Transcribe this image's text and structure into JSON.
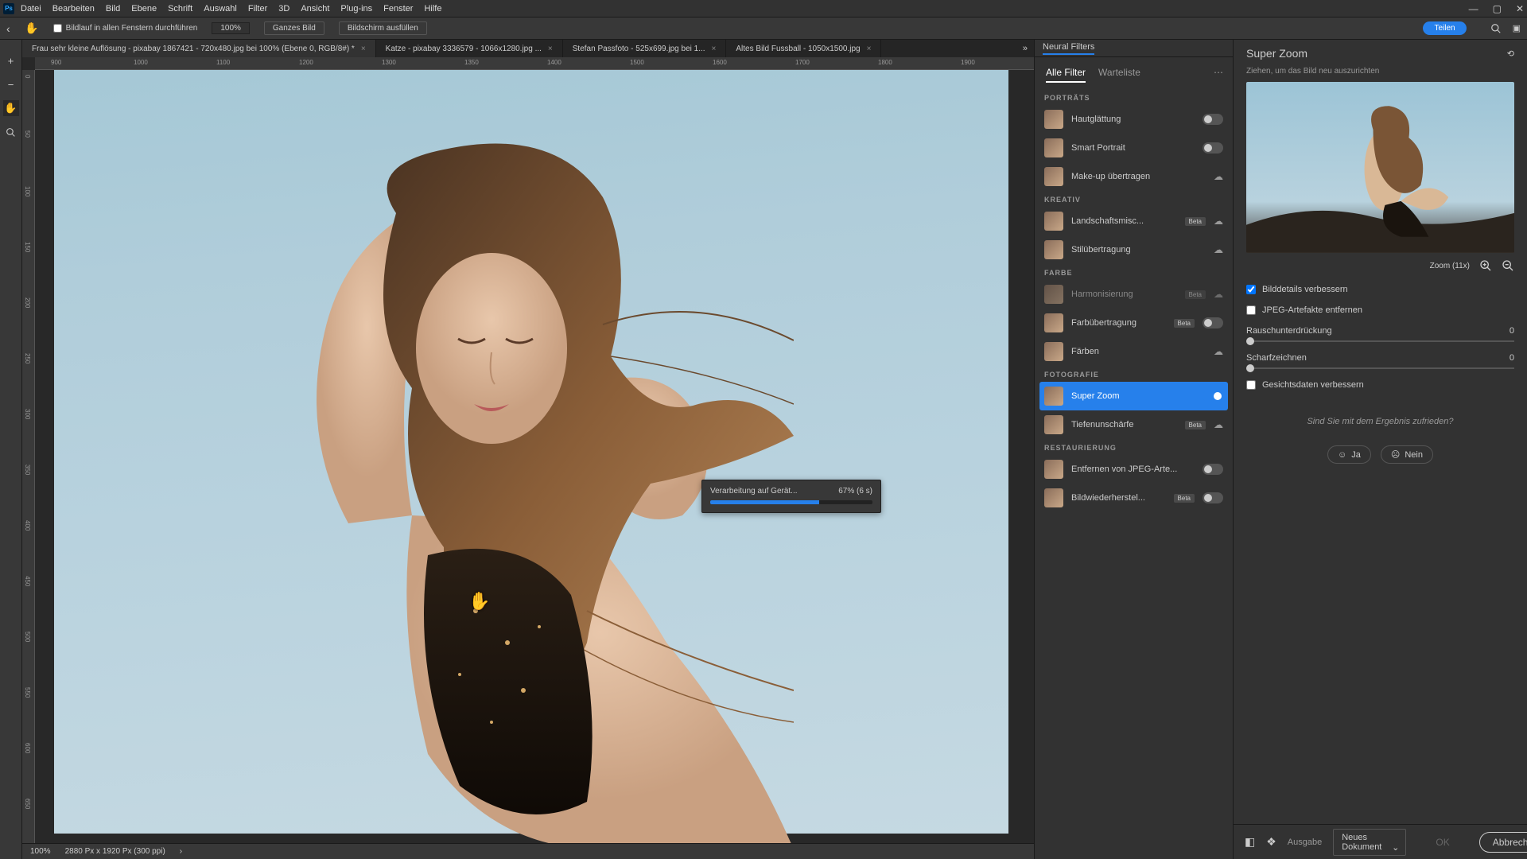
{
  "menu": [
    "Datei",
    "Bearbeiten",
    "Bild",
    "Ebene",
    "Schrift",
    "Auswahl",
    "Filter",
    "3D",
    "Ansicht",
    "Plug-ins",
    "Fenster",
    "Hilfe"
  ],
  "options": {
    "scroll_all": "Bildlauf in allen Fenstern durchführen",
    "zoom": "100%",
    "btn1": "Ganzes Bild",
    "btn2": "Bildschirm ausfüllen",
    "share": "Teilen"
  },
  "tabs": [
    {
      "label": "Frau sehr kleine Auflösung - pixabay 1867421 - 720x480.jpg bei 100% (Ebene 0, RGB/8#) *",
      "active": true
    },
    {
      "label": "Katze - pixabay 3336579 - 1066x1280.jpg ...",
      "active": false
    },
    {
      "label": "Stefan Passfoto - 525x699.jpg bei 1...",
      "active": false
    },
    {
      "label": "Altes Bild Fussball - 1050x1500.jpg",
      "active": false
    }
  ],
  "ruler_h": [
    "900",
    "1000",
    "1100",
    "1200",
    "1300",
    "1350",
    "1400",
    "1500",
    "1600",
    "1700",
    "1800",
    "1900"
  ],
  "ruler_v": [
    "0",
    "50",
    "100",
    "150",
    "200",
    "250",
    "300",
    "350",
    "400",
    "450",
    "500",
    "550",
    "600",
    "650"
  ],
  "progress": {
    "label": "Verarbeitung auf Gerät...",
    "pct": "67% (6 s)",
    "value": 67
  },
  "status": {
    "zoom": "100%",
    "dims": "2880 Px x 1920 Px (300 ppi)"
  },
  "nf": {
    "title": "Neural Filters",
    "tabs": [
      "Alle Filter",
      "Warteliste"
    ],
    "sections": [
      {
        "title": "PORTRÄTS",
        "items": [
          {
            "name": "Hautglättung",
            "ctrl": "toggle",
            "on": false
          },
          {
            "name": "Smart Portrait",
            "ctrl": "toggle",
            "on": false
          },
          {
            "name": "Make-up übertragen",
            "ctrl": "cloud"
          }
        ]
      },
      {
        "title": "KREATIV",
        "items": [
          {
            "name": "Landschaftsmisc...",
            "ctrl": "cloud",
            "beta": true
          },
          {
            "name": "Stilübertragung",
            "ctrl": "cloud"
          }
        ]
      },
      {
        "title": "FARBE",
        "items": [
          {
            "name": "Harmonisierung",
            "ctrl": "cloud",
            "beta": true,
            "dim": true
          },
          {
            "name": "Farbübertragung",
            "ctrl": "toggle",
            "on": false,
            "beta": true
          },
          {
            "name": "Färben",
            "ctrl": "cloud"
          }
        ]
      },
      {
        "title": "FOTOGRAFIE",
        "items": [
          {
            "name": "Super Zoom",
            "ctrl": "toggle",
            "on": true,
            "active": true
          },
          {
            "name": "Tiefenunschärfe",
            "ctrl": "cloud",
            "beta": true
          }
        ]
      },
      {
        "title": "RESTAURIERUNG",
        "items": [
          {
            "name": "Entfernen von JPEG-Arte...",
            "ctrl": "toggle",
            "on": false
          },
          {
            "name": "Bildwiederherstel...",
            "ctrl": "toggle",
            "on": false,
            "beta": true
          }
        ]
      }
    ]
  },
  "sz": {
    "title": "Super Zoom",
    "hint": "Ziehen, um das Bild neu auszurichten",
    "zoom_label": "Zoom (11x)",
    "c1": {
      "label": "Bilddetails verbessern",
      "checked": true
    },
    "c2": {
      "label": "JPEG-Artefakte entfernen",
      "checked": false
    },
    "s1": {
      "label": "Rauschunterdrückung",
      "val": "0"
    },
    "s2": {
      "label": "Scharfzeichnen",
      "val": "0"
    },
    "c3": {
      "label": "Gesichtsdaten verbessern",
      "checked": false
    },
    "feedback": "Sind Sie mit dem Ergebnis zufrieden?",
    "yes": "Ja",
    "no": "Nein"
  },
  "bottom": {
    "output": "Ausgabe",
    "select": "Neues Dokument",
    "ok": "OK",
    "cancel": "Abbrechen"
  }
}
